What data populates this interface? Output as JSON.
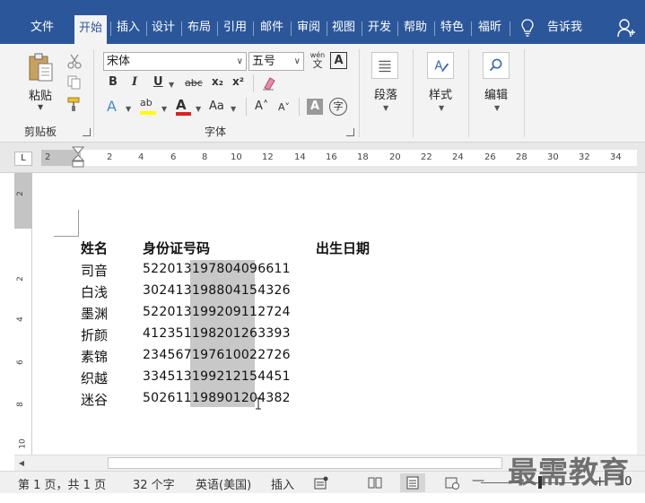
{
  "ribbon_tabs": [
    {
      "label": "文件"
    },
    {
      "label": "开始",
      "active": true
    },
    {
      "label": "插入"
    },
    {
      "label": "设计"
    },
    {
      "label": "布局"
    },
    {
      "label": "引用"
    },
    {
      "label": "邮件"
    },
    {
      "label": "审阅"
    },
    {
      "label": "视图"
    },
    {
      "label": "开发"
    },
    {
      "label": "帮助"
    },
    {
      "label": "特色"
    },
    {
      "label": "福昕"
    }
  ],
  "tell_me": "告诉我",
  "clipboard": {
    "paste_label": "粘贴",
    "group_label": "剪贴板"
  },
  "font": {
    "font_name": "宋体",
    "font_size": "五号",
    "pinyin_label": "wén",
    "pinyin_char": "文",
    "border_char": "A",
    "bold": "B",
    "italic": "I",
    "underline": "U",
    "strike": "abc",
    "subscript": "x₂",
    "superscript": "x²",
    "text_effect": "A",
    "highlight": "ab",
    "font_color": "A",
    "change_case": "Aa",
    "grow": "A˄",
    "shrink": "A˅",
    "shading": "A",
    "enclose": "字",
    "group_label": "字体"
  },
  "paragraph": {
    "label": "段落"
  },
  "styles": {
    "label": "样式"
  },
  "editing": {
    "label": "编辑"
  },
  "ruler": {
    "corner": "L",
    "ticks": [
      "2",
      "2",
      "4",
      "6",
      "8",
      "10",
      "12",
      "14",
      "16",
      "18",
      "20",
      "22",
      "24",
      "26",
      "28",
      "30",
      "32",
      "34"
    ],
    "vertical_ticks": [
      "2",
      "2",
      "4",
      "6",
      "8",
      "10"
    ]
  },
  "document": {
    "headers": [
      "姓名",
      "身份证号码",
      "出生日期"
    ],
    "rows": [
      {
        "name": "司音",
        "id": "522013197804096611"
      },
      {
        "name": "白浅",
        "id": "302413198804154326"
      },
      {
        "name": "墨渊",
        "id": "522013199209112724"
      },
      {
        "name": "折颜",
        "id": "412351198201263393"
      },
      {
        "name": "素锦",
        "id": "234567197610022726"
      },
      {
        "name": "织越",
        "id": "334513199212154451"
      },
      {
        "name": "迷谷",
        "id": "502611198901204382"
      }
    ]
  },
  "status_bar": {
    "page": "第 1 页，共 1 页",
    "words": "32 个字",
    "language": "英语(美国)",
    "mode": "插入",
    "zoom_minus": "—",
    "zoom_plus": "+",
    "zoom": "10"
  },
  "watermark": "最需教育",
  "colors": {
    "ribbon_blue": "#2b579a",
    "selection": "#c8c8c8"
  }
}
